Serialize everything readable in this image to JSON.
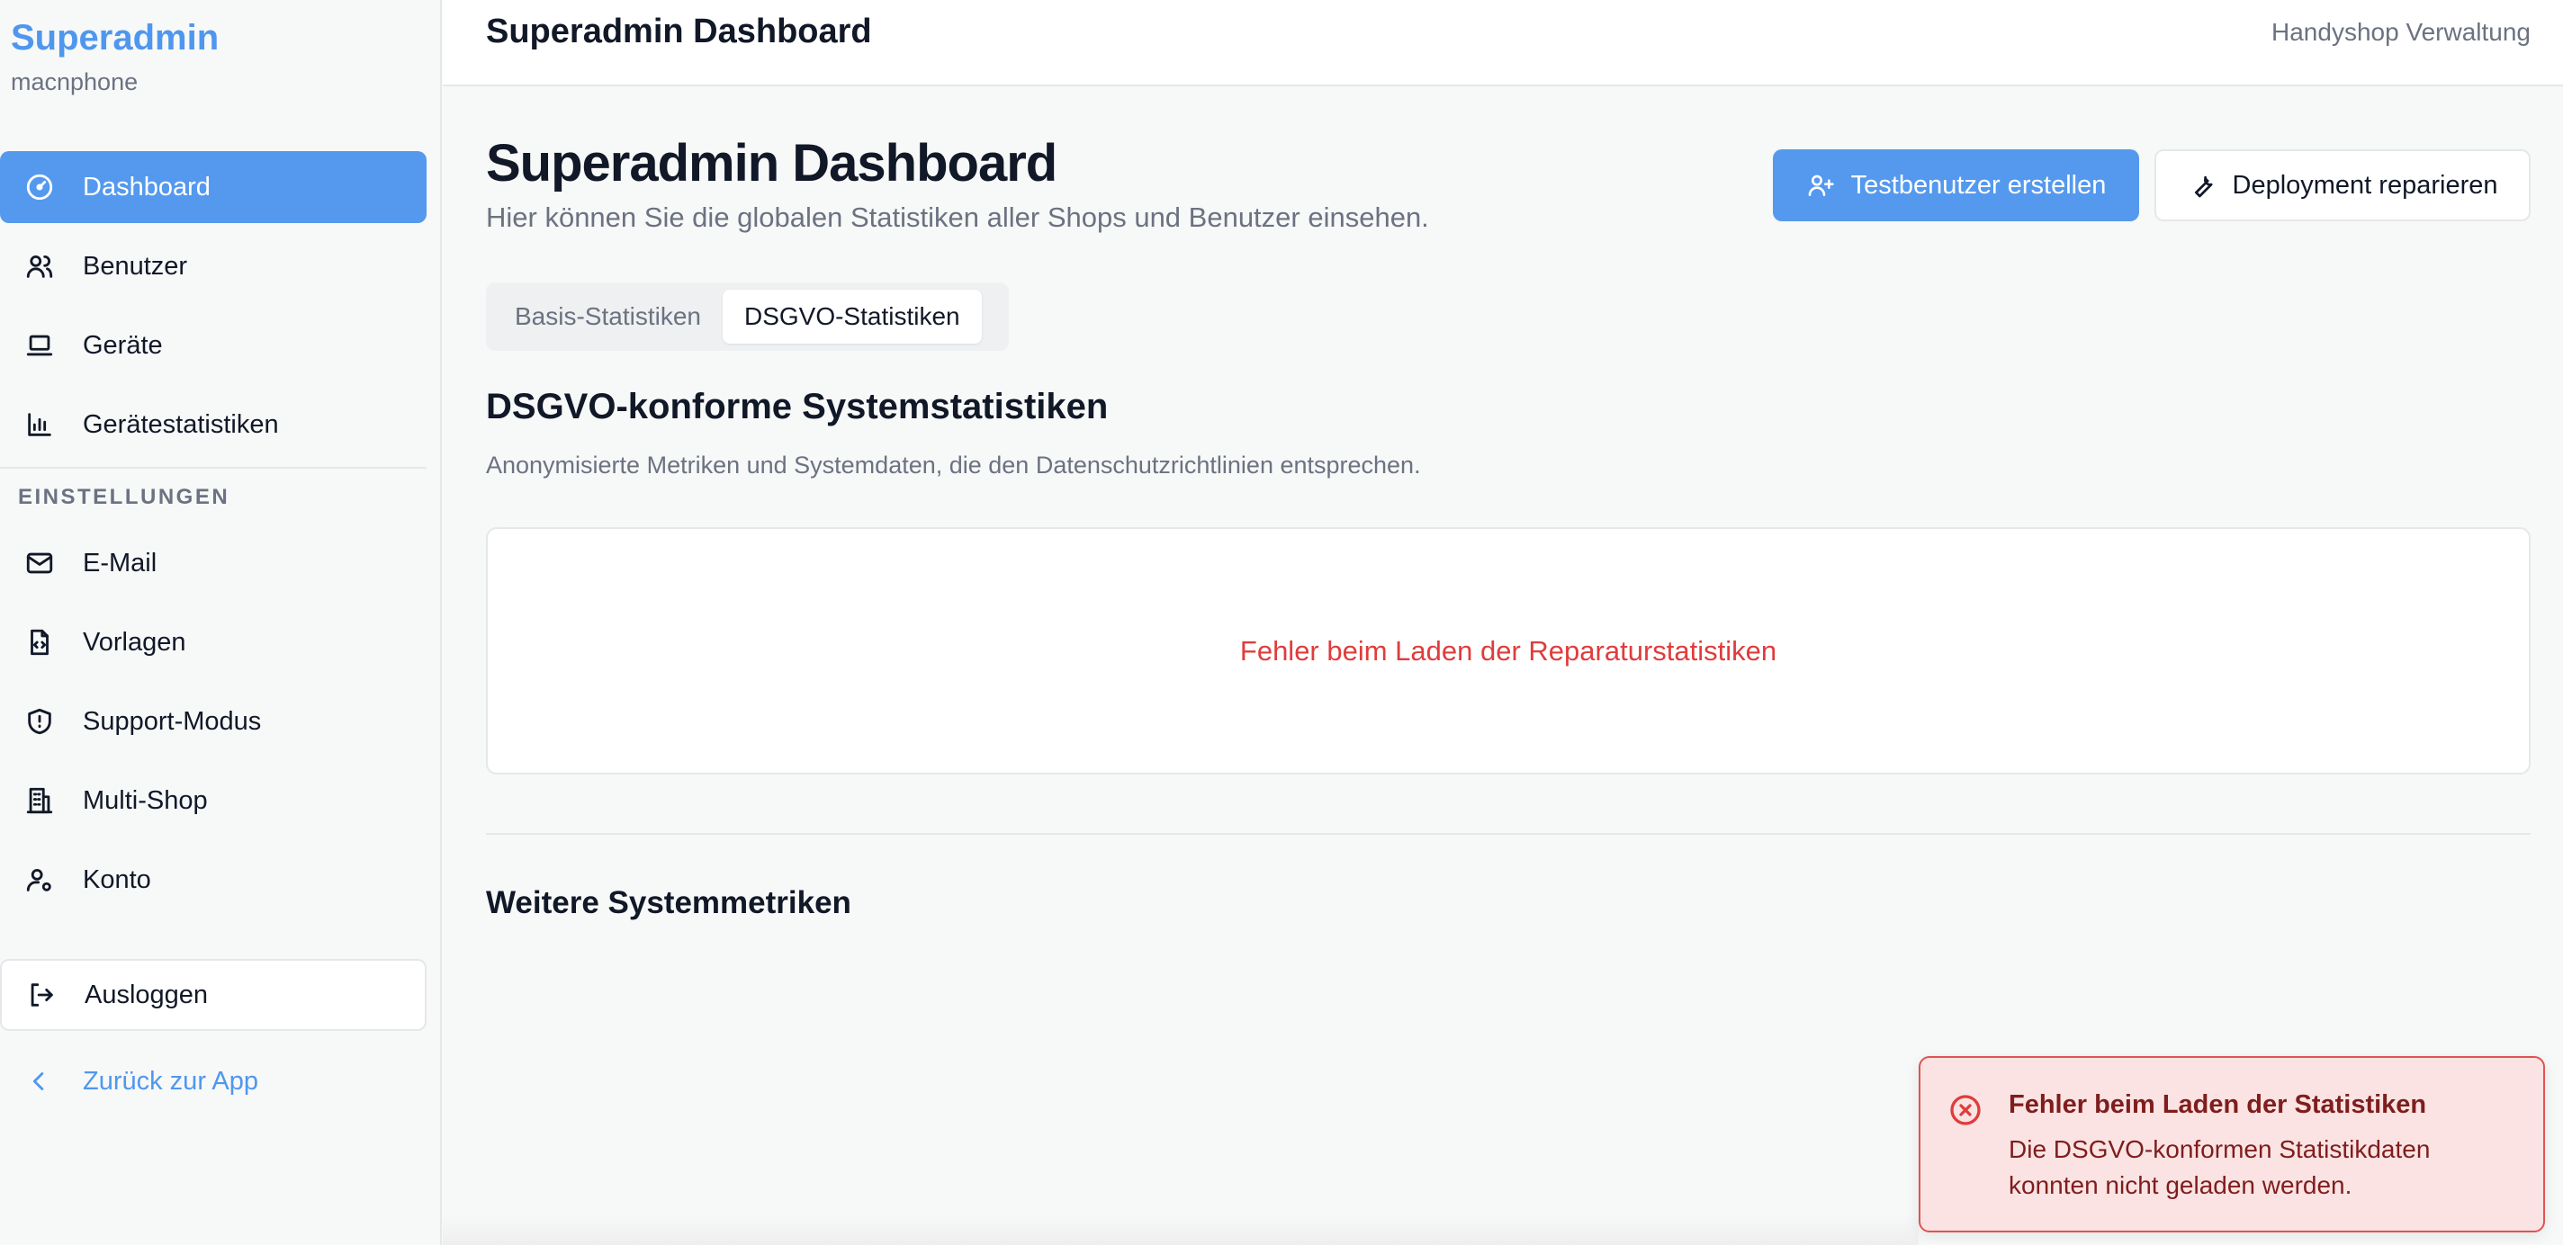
{
  "sidebar": {
    "brand_title": "Superadmin",
    "brand_sub": "macnphone",
    "items": [
      {
        "label": "Dashboard",
        "icon": "gauge-icon",
        "active": true
      },
      {
        "label": "Benutzer",
        "icon": "users-icon"
      },
      {
        "label": "Geräte",
        "icon": "laptop-icon"
      },
      {
        "label": "Gerätestatistiken",
        "icon": "bar-chart-icon"
      }
    ],
    "settings_label": "EINSTELLUNGEN",
    "settings_items": [
      {
        "label": "E-Mail",
        "icon": "mail-icon"
      },
      {
        "label": "Vorlagen",
        "icon": "file-code-icon"
      },
      {
        "label": "Support-Modus",
        "icon": "shield-icon"
      },
      {
        "label": "Multi-Shop",
        "icon": "building-icon"
      },
      {
        "label": "Konto",
        "icon": "user-cog-icon"
      }
    ],
    "logout_label": "Ausloggen",
    "back_label": "Zurück zur App"
  },
  "topbar": {
    "title": "Superadmin Dashboard",
    "right": "Handyshop Verwaltung"
  },
  "main": {
    "title": "Superadmin Dashboard",
    "description": "Hier können Sie die globalen Statistiken aller Shops und Benutzer einsehen.",
    "primary_button": "Testbenutzer erstellen",
    "secondary_button": "Deployment reparieren",
    "tabs": [
      {
        "label": "Basis-Statistiken",
        "active": false
      },
      {
        "label": "DSGVO-Statistiken",
        "active": true
      }
    ],
    "section_title": "DSGVO-konforme Systemstatistiken",
    "section_desc": "Anonymisierte Metriken und Systemdaten, die den Datenschutzrichtlinien entsprechen.",
    "error_text": "Fehler beim Laden der Reparaturstatistiken",
    "sub_title": "Weitere Systemmetriken"
  },
  "toast": {
    "title": "Fehler beim Laden der Statistiken",
    "body": "Die DSGVO-konformen Statistikdaten konnten nicht geladen werden."
  },
  "colors": {
    "accent": "#5499ee",
    "error": "#e03c3c",
    "toast_bg": "#fbe3e3"
  }
}
